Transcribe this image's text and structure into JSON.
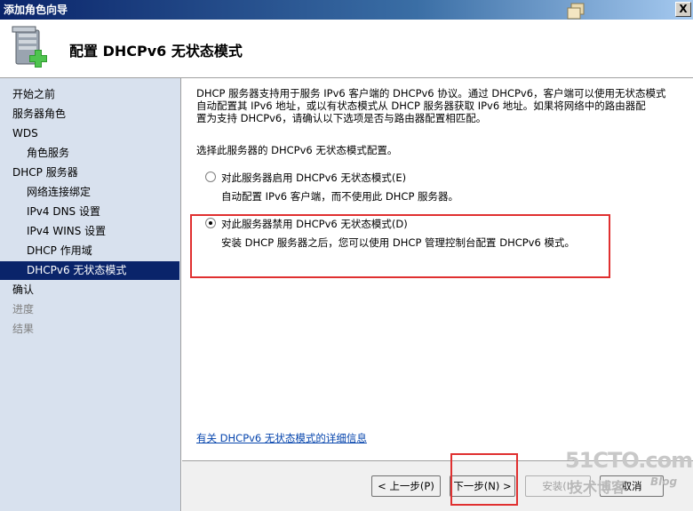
{
  "window": {
    "title": "添加角色向导",
    "close_label": "X"
  },
  "header": {
    "title": "配置 DHCPv6 无状态模式"
  },
  "sidebar": {
    "items": [
      {
        "label": "开始之前",
        "level": 0,
        "state": "normal"
      },
      {
        "label": "服务器角色",
        "level": 0,
        "state": "normal"
      },
      {
        "label": "WDS",
        "level": 0,
        "state": "normal"
      },
      {
        "label": "角色服务",
        "level": 1,
        "state": "normal"
      },
      {
        "label": "DHCP 服务器",
        "level": 0,
        "state": "normal"
      },
      {
        "label": "网络连接绑定",
        "level": 1,
        "state": "normal"
      },
      {
        "label": "IPv4 DNS 设置",
        "level": 1,
        "state": "normal"
      },
      {
        "label": "IPv4 WINS 设置",
        "level": 1,
        "state": "normal"
      },
      {
        "label": "DHCP 作用域",
        "level": 1,
        "state": "normal"
      },
      {
        "label": "DHCPv6 无状态模式",
        "level": 1,
        "state": "active"
      },
      {
        "label": "确认",
        "level": 0,
        "state": "normal"
      },
      {
        "label": "进度",
        "level": 0,
        "state": "disabled"
      },
      {
        "label": "结果",
        "level": 0,
        "state": "disabled"
      }
    ]
  },
  "main": {
    "description_line1": "DHCP 服务器支持用于服务 IPv6 客户端的 DHCPv6 协议。通过 DHCPv6，客户端可以使用无状态模式",
    "description_line2": "自动配置其 IPv6 地址，或以有状态模式从 DHCP 服务器获取 IPv6 地址。如果将网络中的路由器配",
    "description_line3": "置为支持 DHCPv6，请确认以下选项是否与路由器配置相匹配。",
    "prompt": "选择此服务器的 DHCPv6 无状态模式配置。",
    "option_enable_label": "对此服务器启用 DHCPv6 无状态模式(E)",
    "option_enable_desc": "自动配置 IPv6 客户端，而不使用此 DHCP 服务器。",
    "option_enable_checked": false,
    "option_disable_label": "对此服务器禁用 DHCPv6 无状态模式(D)",
    "option_disable_desc": "安装 DHCP 服务器之后，您可以使用 DHCP 管理控制台配置 DHCPv6 模式。",
    "option_disable_checked": true,
    "more_info_link": "有关 DHCPv6 无状态模式的详细信息"
  },
  "footer": {
    "back_label": "< 上一步(P)",
    "next_label": "下一步(N) >",
    "install_label": "安装(I)",
    "cancel_label": "取消"
  },
  "watermark": {
    "site": "51CTO.com",
    "tagline": "技术博客",
    "blog": "Blog"
  },
  "colors": {
    "accent": "#0a246a",
    "sidebar_bg": "#d8e1ee",
    "highlight_box": "#e03030",
    "link": "#0645ad"
  }
}
